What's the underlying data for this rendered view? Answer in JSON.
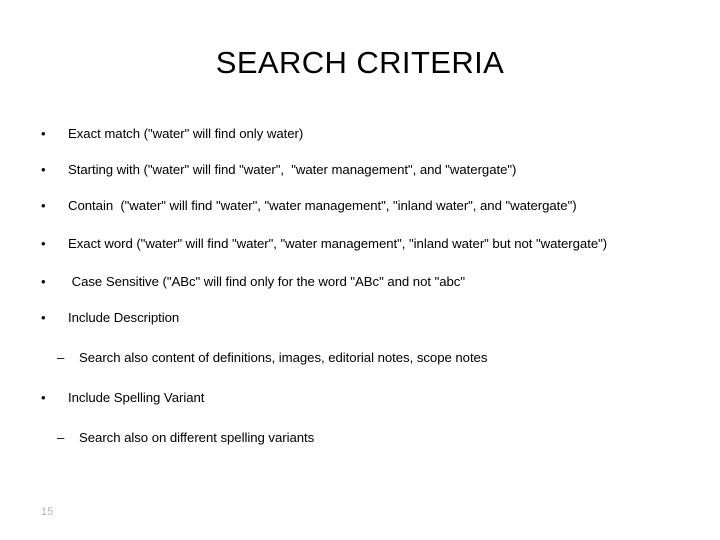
{
  "slide": {
    "title": "SEARCH CRITERIA",
    "page_number": "15",
    "page_number_color": "#b4b4b4",
    "text_color": "#000000",
    "background_color": "#ffffff",
    "bullet_glyph": "•",
    "sub_bullet_glyph": "–",
    "bullets": [
      {
        "marker": "•",
        "level": 1,
        "text": "Exact match (\"water\" will find only water)"
      },
      {
        "marker": "•",
        "level": 1,
        "text": "Starting with (\"water\" will find \"water\",  \"water management\", and \"watergate\")"
      },
      {
        "marker": "•",
        "level": 1,
        "text": "Contain  (\"water\" will find \"water\", \"water management\", \"inland water\", and \"watergate\")"
      },
      {
        "marker": "•",
        "level": 1,
        "text": "Exact word (\"water\" will find \"water\", \"water management\", \"inland water\" but not \"watergate\")"
      },
      {
        "marker": "•",
        "level": 1,
        "text": " Case Sensitive (\"ABc\" will find only for the word \"ABc\" and not \"abc\""
      },
      {
        "marker": "•",
        "level": 1,
        "text": "Include Description"
      },
      {
        "marker": "–",
        "level": 2,
        "text": "Search also content of definitions, images, editorial notes, scope notes"
      },
      {
        "marker": "•",
        "level": 1,
        "text": "Include Spelling Variant"
      },
      {
        "marker": "–",
        "level": 2,
        "text": "Search also on different spelling variants"
      }
    ]
  }
}
